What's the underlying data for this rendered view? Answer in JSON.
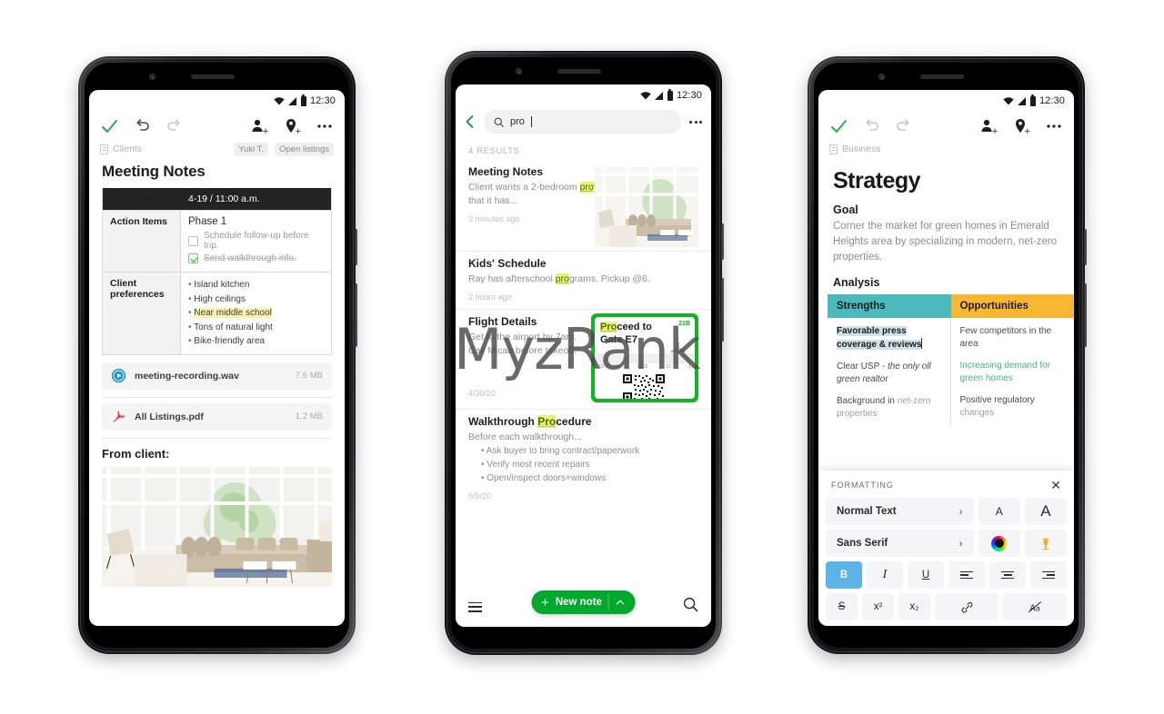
{
  "watermark": "MyzRank",
  "status": {
    "time": "12:30"
  },
  "phone1": {
    "toolbar": {
      "done": "check-icon",
      "undo": "undo-icon",
      "redo": "redo-icon",
      "share": "add-person-icon",
      "tag": "add-tag-icon",
      "more": "more-icon"
    },
    "notebook": "Clients",
    "chips": [
      "Yuki T.",
      "Open listings"
    ],
    "title": "Meeting Notes",
    "table": {
      "header": {
        "label": "Date/Time",
        "value": "4-19 / 11:00 a.m."
      },
      "rows": [
        {
          "label": "Action Items",
          "phase": "Phase 1",
          "checks": [
            {
              "text": "Schedule follow-up before trip.",
              "done": false
            },
            {
              "text": "Send walkthrough info.",
              "done": true
            }
          ]
        },
        {
          "label": "Client preferences",
          "bullets": [
            {
              "text": "Island kitchen",
              "highlight": false
            },
            {
              "text": "High ceilings",
              "highlight": false
            },
            {
              "text": "Near middle school",
              "highlight": true
            },
            {
              "text": "Tons of natural light",
              "highlight": false
            },
            {
              "text": "Bike-friendly area",
              "highlight": false
            }
          ]
        }
      ]
    },
    "attachments": [
      {
        "name": "meeting-recording.wav",
        "size": "7.5 MB",
        "icon": "audio-play-icon"
      },
      {
        "name": "All Listings.pdf",
        "size": "1.2 MB",
        "icon": "pdf-icon"
      }
    ],
    "from_client_label": "From client:"
  },
  "phone2": {
    "search": {
      "query": "pro",
      "placeholder": "Search",
      "back": "back-chevron-icon",
      "more": "more-icon"
    },
    "results_count": "4 RESULTS",
    "results": [
      {
        "title": "Meeting Notes",
        "body_before": "Client wants a 2-bedroom ",
        "match": "pro",
        "body_after": "vided that it has...",
        "time": "3 minutes ago",
        "thumb": "living-room-photo"
      },
      {
        "title": "Kids' Schedule",
        "body_before": "Ray has afterschool ",
        "match": "pro",
        "body_after": "grams. Pickup @6.",
        "time": "2 hours ago"
      },
      {
        "title": "Flight Details",
        "body_line1": "Get to the airport by 7am.",
        "body_line2": "Call Micah before takeoff.",
        "time": "4/30/20",
        "pass": {
          "match": "Pro",
          "line1_rest": "ceed to",
          "line2": "Gate E7",
          "seat": "21B",
          "meta": [
            "10:15 AM",
            "1902",
            "12",
            "1"
          ]
        }
      },
      {
        "title_before": "Walkthrough ",
        "title_match": "Pro",
        "title_after": "cedure",
        "body": "Before each walkthrough...",
        "bullets": [
          "Ask buyer to bring contract/paperwork",
          "Verify most recent repairs",
          "Open/inspect doors+windows"
        ],
        "time": "5/9/20"
      }
    ],
    "fab": {
      "label": "New note",
      "plus": "plus-icon",
      "chevron": "chevron-up-icon"
    },
    "bottom": {
      "menu": "hamburger-icon",
      "search": "search-icon"
    }
  },
  "phone3": {
    "toolbar": {
      "done": "check-icon",
      "undo": "undo-icon",
      "redo": "redo-icon",
      "share": "add-person-icon",
      "tag": "add-tag-icon",
      "more": "more-icon"
    },
    "notebook": "Business",
    "title": "Strategy",
    "goal_heading": "Goal",
    "goal_text": "Corner the market for green homes in Emerald Heights area by specializing in modern, net-zero properties.",
    "analysis_heading": "Analysis",
    "swot": {
      "columns": [
        {
          "header": "Strengths",
          "color": "#4cb9bd",
          "items": [
            {
              "text": "Favorable press coverage & reviews",
              "style": "selected"
            },
            {
              "text": "Clear USP - ",
              "italic_text": "the only oll green realtor",
              "style": "normal"
            },
            {
              "text": "Background in ",
              "faded_text": "net-zero properties",
              "style": "normal"
            }
          ]
        },
        {
          "header": "Opportunities",
          "color": "#f7b733",
          "items": [
            {
              "text": "Few competitors in the area",
              "style": "normal"
            },
            {
              "text": "Increasing demand for green homes",
              "style": "green"
            },
            {
              "text": "Positive regulatory ",
              "faded_text": "changes",
              "style": "normal"
            }
          ]
        }
      ]
    },
    "formatting": {
      "label": "FORMATTING",
      "close": "close-icon",
      "rows": [
        [
          {
            "name": "paragraph-style",
            "label": "Normal Text",
            "type": "wide"
          },
          {
            "name": "decrease-font-size",
            "label": "A",
            "type": "small-a"
          },
          {
            "name": "increase-font-size",
            "label": "A",
            "type": "big-a"
          }
        ],
        [
          {
            "name": "font-family",
            "label": "Sans Serif",
            "type": "wide"
          },
          {
            "name": "text-color",
            "label": "",
            "type": "color-wheel"
          },
          {
            "name": "highlight-color",
            "label": "",
            "type": "highlighter"
          }
        ],
        [
          {
            "name": "bold",
            "label": "B",
            "type": "btn",
            "active": true
          },
          {
            "name": "italic",
            "label": "I",
            "type": "btn"
          },
          {
            "name": "underline",
            "label": "U",
            "type": "btn"
          },
          {
            "name": "align-left",
            "label": "",
            "type": "align-left"
          },
          {
            "name": "align-center",
            "label": "",
            "type": "align-center"
          },
          {
            "name": "align-right",
            "label": "",
            "type": "align-right"
          }
        ],
        [
          {
            "name": "strikethrough",
            "label": "S",
            "type": "btn"
          },
          {
            "name": "superscript",
            "label": "x²",
            "type": "btn"
          },
          {
            "name": "subscript",
            "label": "x₂",
            "type": "btn"
          },
          {
            "name": "insert-link",
            "label": "",
            "type": "link"
          },
          {
            "name": "clear-formatting",
            "label": "",
            "type": "clear"
          }
        ]
      ]
    }
  }
}
